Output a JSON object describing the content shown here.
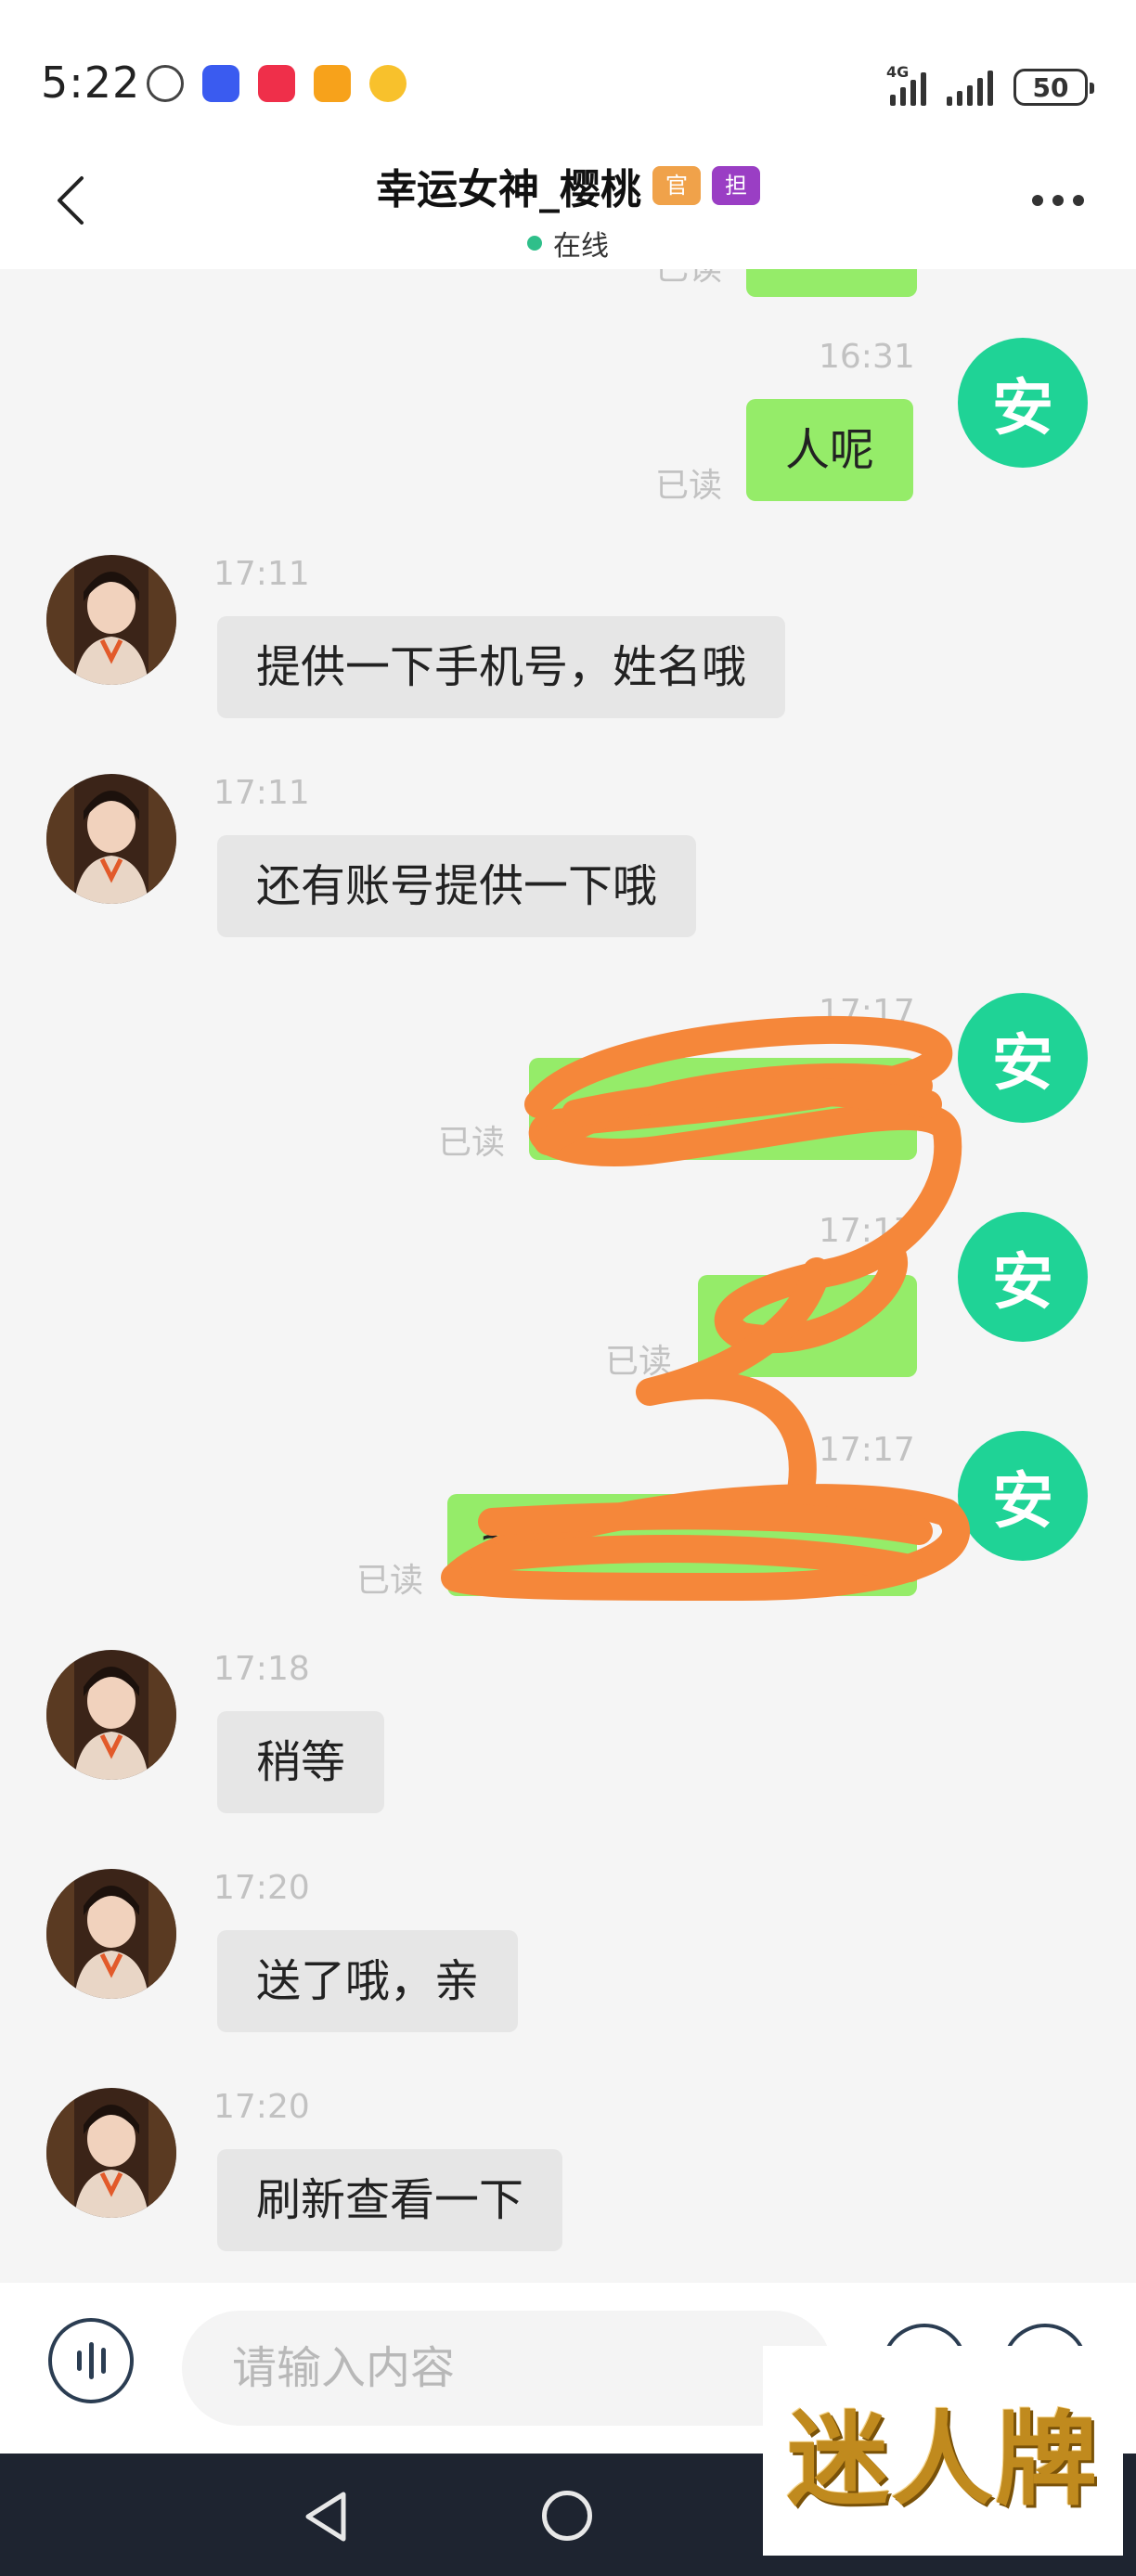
{
  "status_bar": {
    "time": "5:22",
    "network": "4G",
    "battery": "50"
  },
  "header": {
    "title": "幸运女神_樱桃",
    "badge_official": "官",
    "badge_host": "担",
    "status": "在线"
  },
  "messages": [
    {
      "time": "16:31",
      "sender": "me",
      "text": "人呢",
      "read": "已读"
    },
    {
      "time": "17:11",
      "sender": "her",
      "text": "提供一下手机号，姓名哦"
    },
    {
      "time": "17:11",
      "sender": "her",
      "text": "还有账号提供一下哦"
    },
    {
      "time": "17:17",
      "sender": "me",
      "text": "",
      "read": "已读",
      "redacted": true
    },
    {
      "time": "17:17",
      "sender": "me",
      "text": "",
      "read": "已读",
      "redacted": true
    },
    {
      "time": "17:17",
      "sender": "me",
      "text": "a",
      "read": "已读",
      "redacted": true
    },
    {
      "time": "17:18",
      "sender": "her",
      "text": "稍等"
    },
    {
      "time": "17:20",
      "sender": "her",
      "text": "送了哦，亲"
    },
    {
      "time": "17:20",
      "sender": "her",
      "text": "刷新查看一下"
    }
  ],
  "my_avatar_text": "安",
  "input": {
    "placeholder": "请输入内容"
  },
  "watermark": "迷人牌",
  "colors": {
    "accent_green": "#1fd396",
    "my_bubble": "#95ec69",
    "their_bubble": "#e6e6e6",
    "scribble": "#f5873a"
  }
}
